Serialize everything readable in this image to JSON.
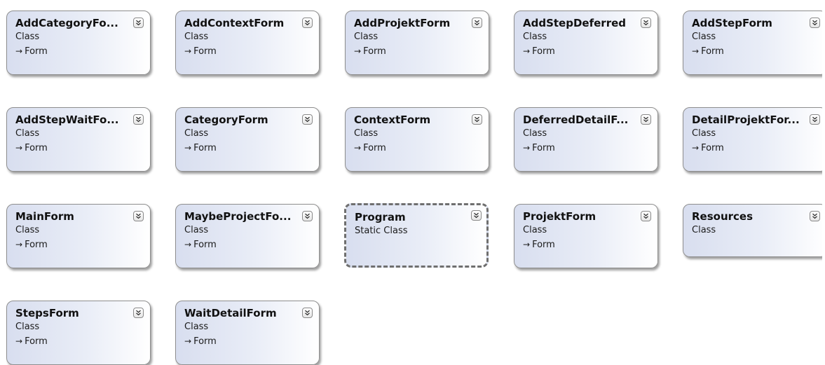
{
  "classes": [
    {
      "name": "AddCategoryFo...",
      "kind": "Class",
      "base": "Form"
    },
    {
      "name": "AddContextForm",
      "kind": "Class",
      "base": "Form"
    },
    {
      "name": "AddProjektForm",
      "kind": "Class",
      "base": "Form"
    },
    {
      "name": "AddStepDeferred",
      "kind": "Class",
      "base": "Form"
    },
    {
      "name": "AddStepForm",
      "kind": "Class",
      "base": "Form"
    },
    {
      "name": "AddStepWaitFo...",
      "kind": "Class",
      "base": "Form"
    },
    {
      "name": "CategoryForm",
      "kind": "Class",
      "base": "Form"
    },
    {
      "name": "ContextForm",
      "kind": "Class",
      "base": "Form"
    },
    {
      "name": "DeferredDetailF...",
      "kind": "Class",
      "base": "Form"
    },
    {
      "name": "DetailProjektFor...",
      "kind": "Class",
      "base": "Form"
    },
    {
      "name": "MainForm",
      "kind": "Class",
      "base": "Form"
    },
    {
      "name": "MaybeProjectFo...",
      "kind": "Class",
      "base": "Form"
    },
    {
      "name": "Program",
      "kind": "Static Class",
      "base": ""
    },
    {
      "name": "ProjektForm",
      "kind": "Class",
      "base": "Form"
    },
    {
      "name": "Resources",
      "kind": "Class",
      "base": ""
    },
    {
      "name": "StepsForm",
      "kind": "Class",
      "base": "Form"
    },
    {
      "name": "WaitDetailForm",
      "kind": "Class",
      "base": "Form"
    }
  ],
  "icons": {
    "toggle": "double-chevron-down-icon",
    "inheritance": "inheritance-arrow-icon"
  },
  "colors": {
    "card_gradient_start": "#d8deef",
    "card_gradient_end": "#ffffff",
    "border": "#8e8e8e",
    "selected_border": "#6f6f6f"
  }
}
